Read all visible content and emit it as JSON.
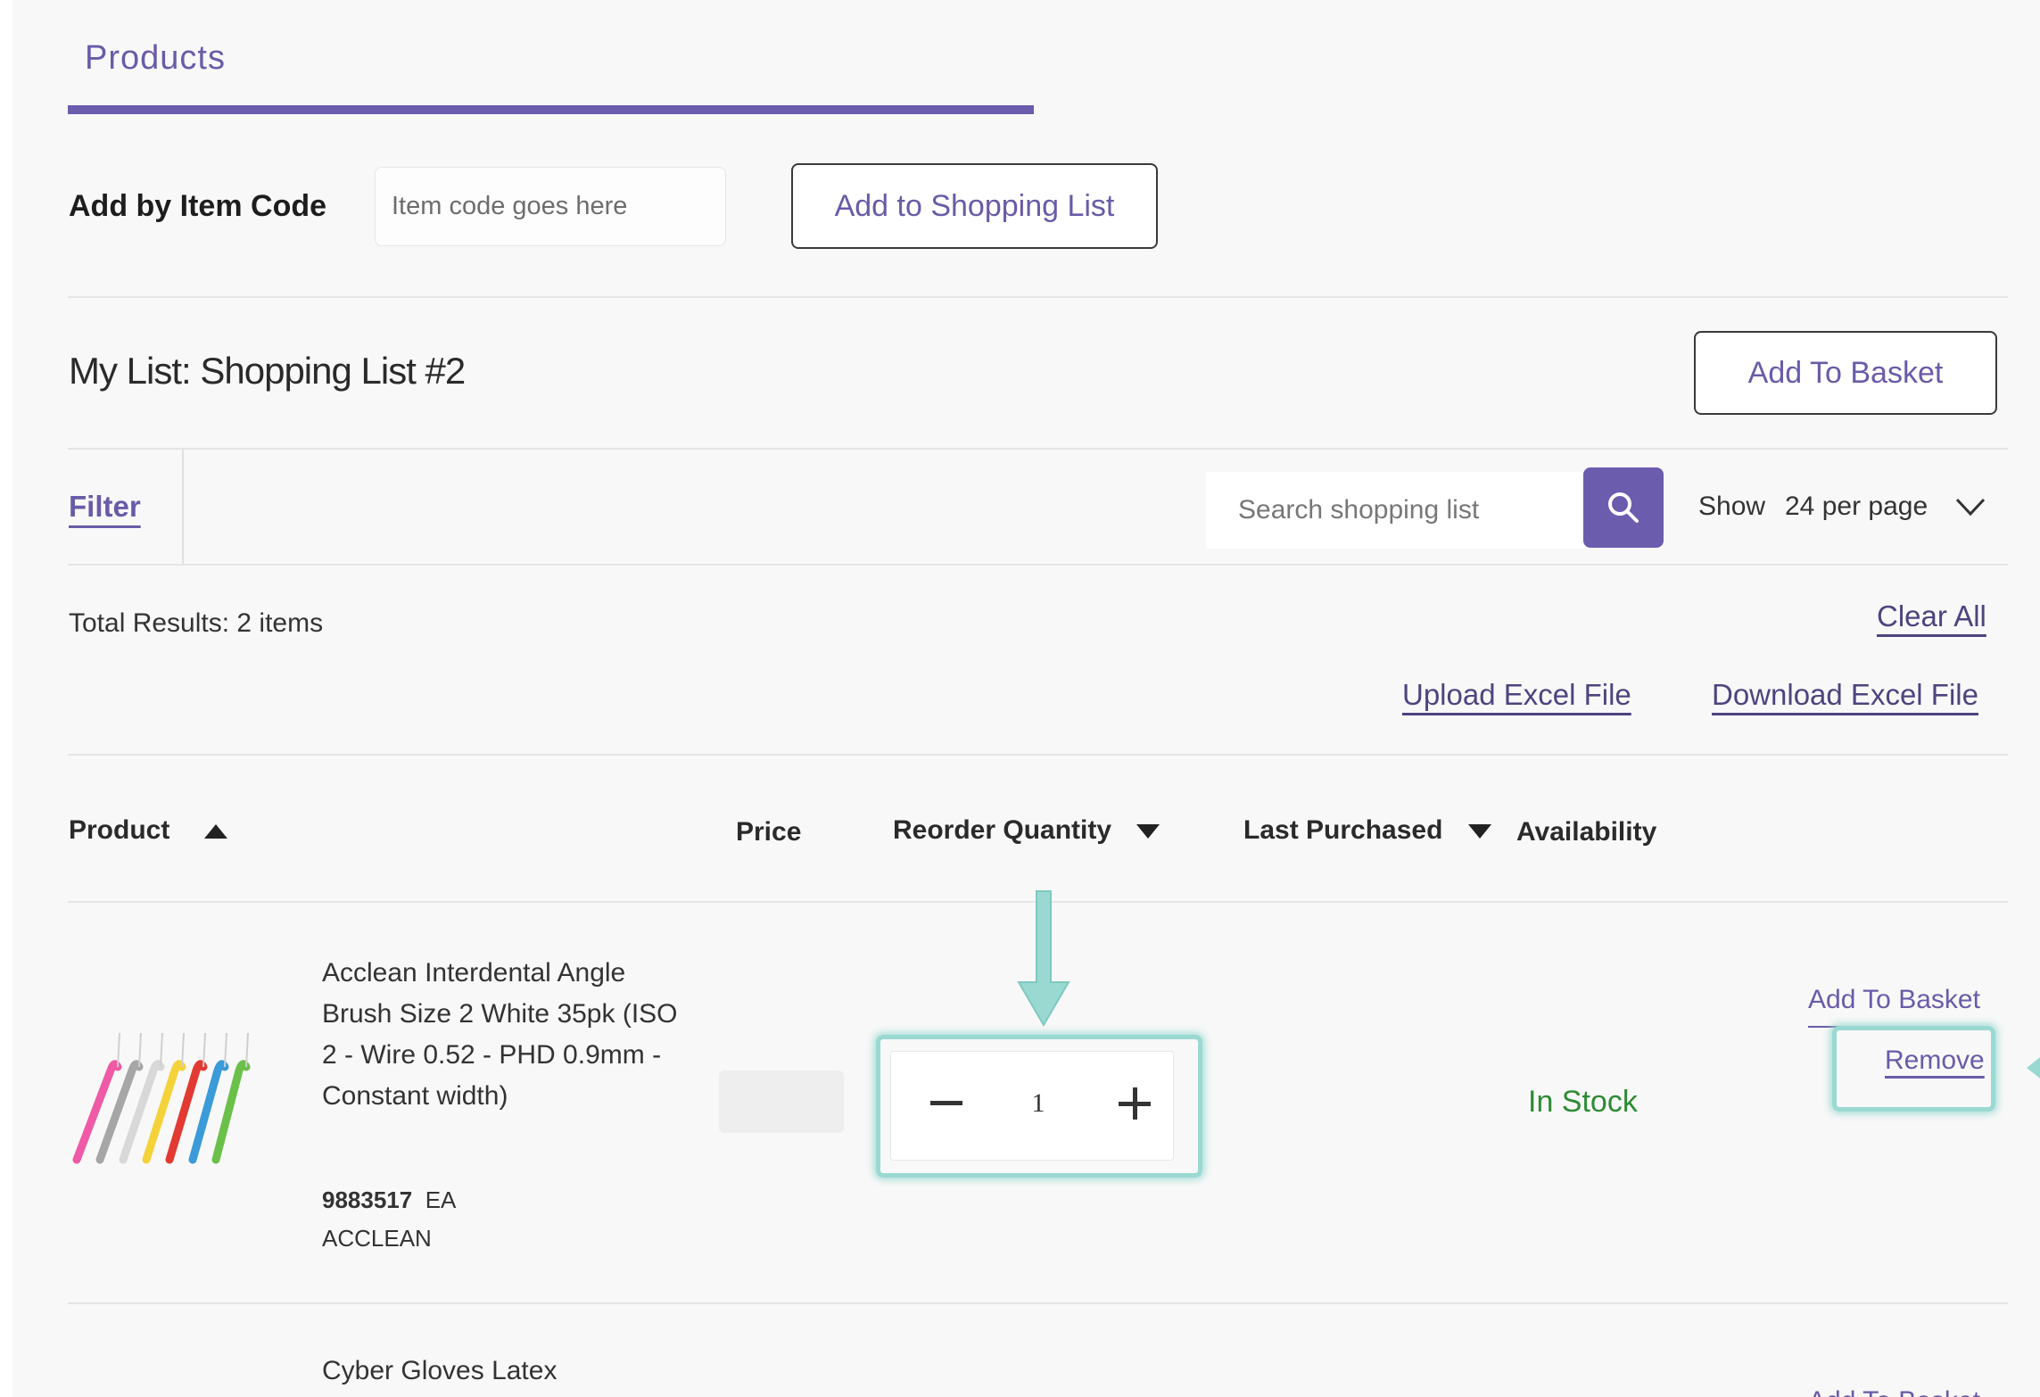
{
  "tabs": {
    "products_label": "Products"
  },
  "add_by_code": {
    "label": "Add by Item Code",
    "placeholder": "Item code goes here",
    "button_label": "Add to Shopping List"
  },
  "list": {
    "title": "My List: Shopping List #2",
    "add_to_basket_label": "Add To Basket"
  },
  "toolbar": {
    "filter_label": "Filter",
    "search_placeholder": "Search shopping list",
    "show_label": "Show",
    "per_page_value": "24 per page"
  },
  "results": {
    "total_text": "Total Results: 2 items",
    "clear_all_label": "Clear All",
    "upload_label": "Upload Excel File",
    "download_label": "Download Excel File"
  },
  "table": {
    "headers": {
      "product": "Product",
      "price": "Price",
      "reorder_quantity": "Reorder Quantity",
      "last_purchased": "Last Purchased",
      "availability": "Availability"
    },
    "rows": [
      {
        "name": "Acclean Interdental Angle Brush Size 2 White 35pk (ISO 2 - Wire 0.52 - PHD 0.9mm - Constant width)",
        "code": "9883517",
        "unit": "EA",
        "brand": "ACCLEAN",
        "quantity": "1",
        "availability": "In Stock",
        "add_to_basket_label": "Add To Basket",
        "remove_label": "Remove"
      },
      {
        "name": "Cyber Gloves Latex",
        "add_to_basket_label": "Add To Basket"
      }
    ]
  },
  "colors": {
    "accent": "#6c5cae",
    "in_stock": "#2e8b35",
    "highlight": "#9ad9d2"
  }
}
